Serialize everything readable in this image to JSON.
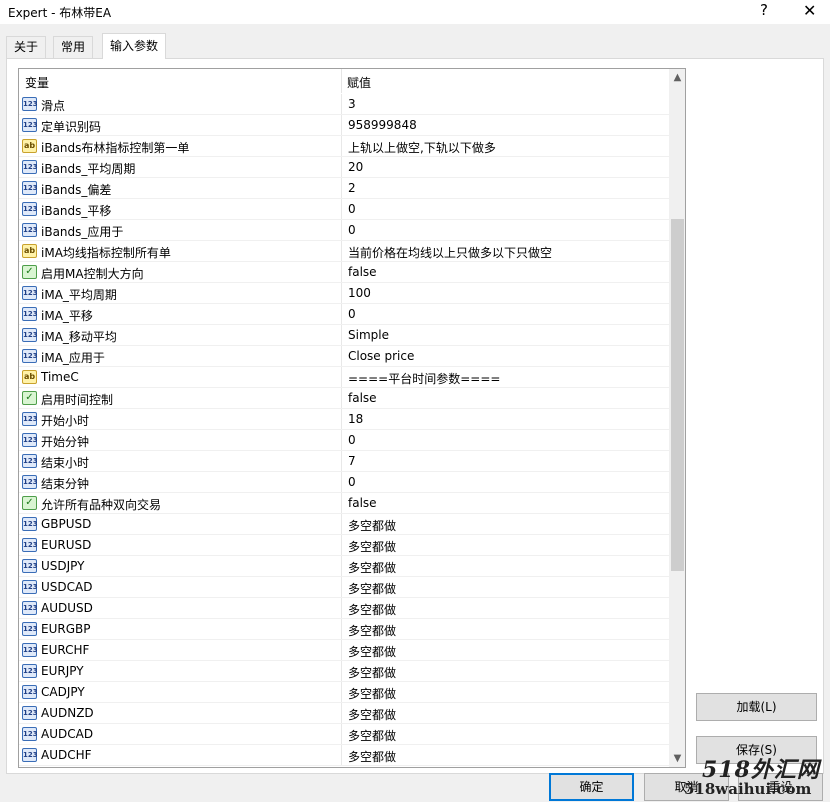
{
  "window": {
    "title": "Expert - 布林带EA",
    "help": "?",
    "close": "✕"
  },
  "tabs": [
    {
      "label": "关于"
    },
    {
      "label": "常用"
    },
    {
      "label": "输入参数"
    }
  ],
  "grid": {
    "header": {
      "variable": "变量",
      "value": "赋值"
    },
    "rows": [
      {
        "type": "num",
        "icon": "123",
        "name": "滑点",
        "value": "3"
      },
      {
        "type": "num",
        "icon": "123",
        "name": "定单识别码",
        "value": "958999848"
      },
      {
        "type": "str",
        "icon": "ab",
        "name": "iBands布林指标控制第一单",
        "value": "上轨以上做空,下轨以下做多"
      },
      {
        "type": "num",
        "icon": "123",
        "name": "iBands_平均周期",
        "value": "20"
      },
      {
        "type": "num",
        "icon": "123",
        "name": "iBands_偏差",
        "value": "2"
      },
      {
        "type": "num",
        "icon": "123",
        "name": "iBands_平移",
        "value": "0"
      },
      {
        "type": "num",
        "icon": "123",
        "name": "iBands_应用于",
        "value": "0"
      },
      {
        "type": "str",
        "icon": "ab",
        "name": "iMA均线指标控制所有单",
        "value": "当前价格在均线以上只做多以下只做空"
      },
      {
        "type": "bool",
        "icon": "✓",
        "name": "启用MA控制大方向",
        "value": "false"
      },
      {
        "type": "num",
        "icon": "123",
        "name": "iMA_平均周期",
        "value": "100"
      },
      {
        "type": "num",
        "icon": "123",
        "name": "iMA_平移",
        "value": "0"
      },
      {
        "type": "num",
        "icon": "123",
        "name": "iMA_移动平均",
        "value": "Simple"
      },
      {
        "type": "num",
        "icon": "123",
        "name": "iMA_应用于",
        "value": "Close price"
      },
      {
        "type": "str",
        "icon": "ab",
        "name": "TimeC",
        "value": "====平台时间参数===="
      },
      {
        "type": "bool",
        "icon": "✓",
        "name": "启用时间控制",
        "value": "false"
      },
      {
        "type": "num",
        "icon": "123",
        "name": "开始小时",
        "value": "18"
      },
      {
        "type": "num",
        "icon": "123",
        "name": "开始分钟",
        "value": "0"
      },
      {
        "type": "num",
        "icon": "123",
        "name": "结束小时",
        "value": "7"
      },
      {
        "type": "num",
        "icon": "123",
        "name": "结束分钟",
        "value": "0"
      },
      {
        "type": "bool",
        "icon": "✓",
        "name": "允许所有品种双向交易",
        "value": "false"
      },
      {
        "type": "num",
        "icon": "123",
        "name": "GBPUSD",
        "value": "多空都做"
      },
      {
        "type": "num",
        "icon": "123",
        "name": "EURUSD",
        "value": "多空都做"
      },
      {
        "type": "num",
        "icon": "123",
        "name": "USDJPY",
        "value": "多空都做"
      },
      {
        "type": "num",
        "icon": "123",
        "name": "USDCAD",
        "value": "多空都做"
      },
      {
        "type": "num",
        "icon": "123",
        "name": "AUDUSD",
        "value": "多空都做"
      },
      {
        "type": "num",
        "icon": "123",
        "name": "EURGBP",
        "value": "多空都做"
      },
      {
        "type": "num",
        "icon": "123",
        "name": "EURCHF",
        "value": "多空都做"
      },
      {
        "type": "num",
        "icon": "123",
        "name": "EURJPY",
        "value": "多空都做"
      },
      {
        "type": "num",
        "icon": "123",
        "name": "CADJPY",
        "value": "多空都做"
      },
      {
        "type": "num",
        "icon": "123",
        "name": "AUDNZD",
        "value": "多空都做"
      },
      {
        "type": "num",
        "icon": "123",
        "name": "AUDCAD",
        "value": "多空都做"
      },
      {
        "type": "num",
        "icon": "123",
        "name": "AUDCHF",
        "value": "多空都做"
      }
    ],
    "scroll": {
      "up": "▲",
      "down": "▼"
    }
  },
  "buttons": {
    "load": "加载(L)",
    "save": "保存(S)",
    "ok": "确定",
    "cancel": "取消",
    "reset": "重设"
  },
  "watermark": {
    "line1": "518外汇网",
    "line2": "518waihui.com"
  }
}
